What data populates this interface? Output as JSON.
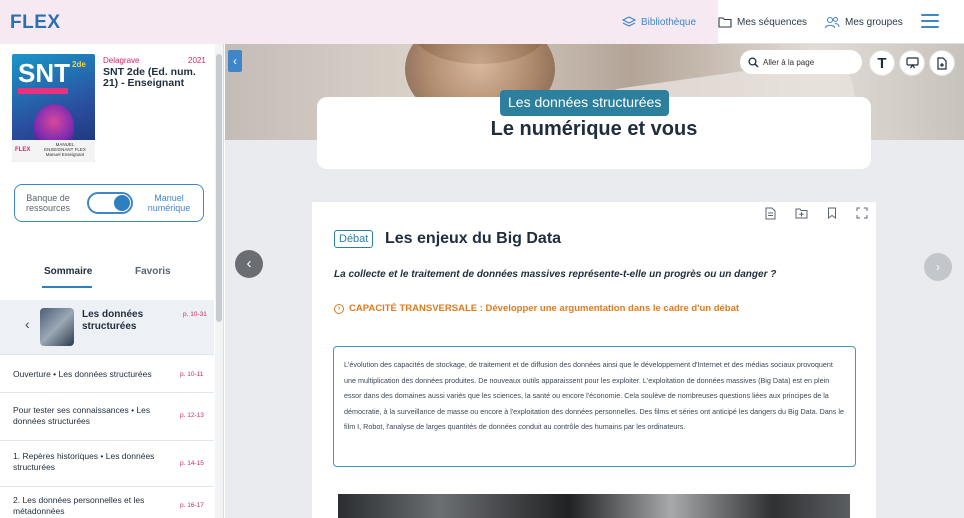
{
  "app": {
    "logo": "FLEX"
  },
  "header": {
    "nav": [
      {
        "label": "Bibliothèque",
        "icon": "layers-icon"
      },
      {
        "label": "Mes séquences",
        "icon": "folder-icon"
      },
      {
        "label": "Mes groupes",
        "icon": "users-icon"
      }
    ],
    "menu_icon": "hamburger-icon"
  },
  "book": {
    "publisher": "Delagrave",
    "year": "2021",
    "title": "SNT 2de (Ed. num. 21) - Enseignant",
    "cover": {
      "series": "SNT",
      "level": "2de",
      "flex_label": "FLEX",
      "manual_label": "MANUEL ENSEIGNANT FLEX Manuel Enseignant"
    }
  },
  "toggle": {
    "left_label": "Banque de ressources",
    "right_label": "Manuel numérique",
    "state": "numérique"
  },
  "tabs": {
    "sommaire": "Sommaire",
    "favoris": "Favoris"
  },
  "chapter": {
    "title": "Les données structurées",
    "pages": "p. 10-31"
  },
  "toc": [
    {
      "label": "Ouverture • Les données structurées",
      "pages": "p. 10-11"
    },
    {
      "label": "Pour tester ses connaissances • Les données structurées",
      "pages": "p. 12-13"
    },
    {
      "label": "1. Repères historiques • Les données structurées",
      "pages": "p. 14-15"
    },
    {
      "label": "2. Les données personnelles et les métadonnées",
      "pages": "p. 16-17"
    }
  ],
  "main": {
    "chapter_badge": "Les données structurées",
    "title": "Le numérique et vous",
    "goto_placeholder": "Aller à la page",
    "tool_buttons": [
      "T"
    ],
    "doc": {
      "tag": "Débat",
      "title": "Les enjeux du Big Data",
      "question": "La collecte et le traitement de données massives représente-t-elle un progrès ou un danger ?",
      "capacite": "CAPACITÉ TRANSVERSALE : Développer une argumentation dans le cadre d'un débat",
      "text": "L'évolution des capacités de stockage, de traitement et de diffusion des données ainsi que le développement d'Internet et des médias sociaux provoquent une multiplication des données produites. De nouveaux outils apparaissent pour les exploiter. L'exploitation de données massives (Big Data) est en plein essor dans des domaines aussi variés que les sciences, la santé ou encore l'économie. Cela soulève de nombreuses questions liées aux principes de la démocratie, à la surveillance de masse ou encore à l'exploitation des données personnelles. Des films et séries ont anticipé les dangers du Big Data. Dans le film I, Robot, l'analyse de larges quantités de données conduit au contrôle des humains par les ordinateurs."
    }
  },
  "colors": {
    "accent_blue": "#3f86c9",
    "teal": "#2d7f9e",
    "pink": "#d2266b",
    "orange": "#e07a1f"
  }
}
